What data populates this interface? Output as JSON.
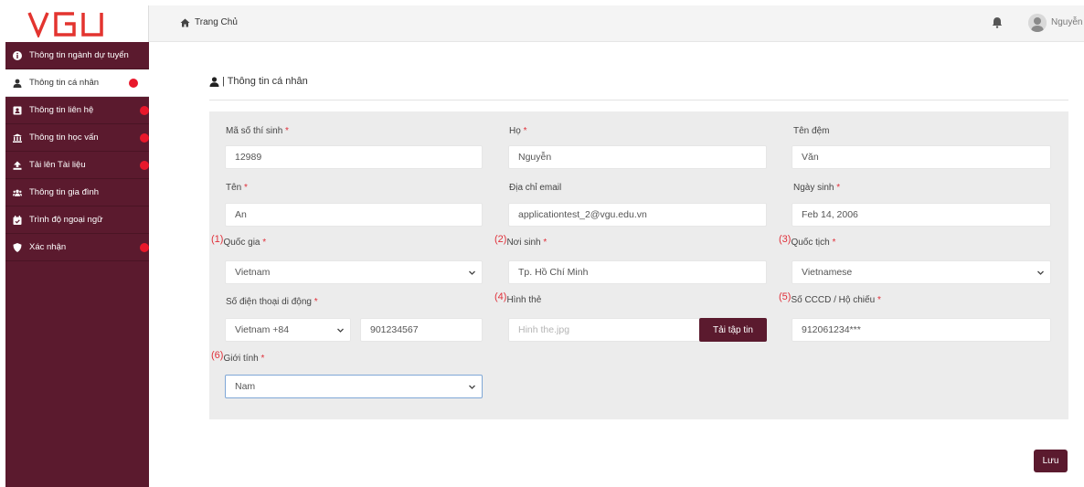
{
  "logo": {
    "text": "VGU"
  },
  "sidebar": {
    "items": [
      {
        "label": "Thông tin ngành dự tuyển",
        "icon": "info-circle-icon",
        "dot": false,
        "active": false
      },
      {
        "label": "Thông tin cá nhân",
        "icon": "user-icon",
        "dot": true,
        "active": true
      },
      {
        "label": "Thông tin liên hệ",
        "icon": "address-book-icon",
        "dot": true,
        "active": false
      },
      {
        "label": "Thông tin học vấn",
        "icon": "university-icon",
        "dot": true,
        "active": false
      },
      {
        "label": "Tải lên Tài liệu",
        "icon": "upload-icon",
        "dot": true,
        "active": false
      },
      {
        "label": "Thông tin gia đình",
        "icon": "users-icon",
        "dot": false,
        "active": false
      },
      {
        "label": "Trình độ ngoại ngữ",
        "icon": "calendar-check-icon",
        "dot": false,
        "active": false
      },
      {
        "label": "Xác nhận",
        "icon": "shield-icon",
        "dot": true,
        "active": false
      }
    ]
  },
  "topbar": {
    "home_label": "Trang Chủ",
    "username": "Nguyễn"
  },
  "page": {
    "title": "| Thông tin cá nhân"
  },
  "form": {
    "student_id": {
      "label": "Mã số thí sinh",
      "value": "12989"
    },
    "last_name": {
      "label": "Họ",
      "value": "Nguyễn"
    },
    "middle_name": {
      "label": "Tên đệm",
      "value": "Văn"
    },
    "first_name": {
      "label": "Tên",
      "value": "An"
    },
    "email": {
      "label": "Địa chỉ email",
      "value": "applicationtest_2@vgu.edu.vn"
    },
    "birth_date": {
      "label": "Ngày sinh",
      "value": "Feb 14, 2006"
    },
    "country": {
      "num": "(1)",
      "label": "Quốc gia",
      "value": "Vietnam"
    },
    "birth_place": {
      "num": "(2)",
      "label": "Nơi sinh",
      "value": "Tp. Hồ Chí Minh"
    },
    "nationality": {
      "num": "(3)",
      "label": "Quốc tịch",
      "value": "Vietnamese"
    },
    "phone": {
      "label": "Số điện thoại di động",
      "code": "Vietnam +84",
      "value": "901234567"
    },
    "photo": {
      "num": "(4)",
      "label": "Hình thẻ",
      "placeholder": "Hinh the.jpg",
      "button": "Tải tập tin"
    },
    "id_card": {
      "num": "(5)",
      "label": "Số CCCD / Hộ chiếu",
      "value": "912061234***"
    },
    "gender": {
      "num": "(6)",
      "label": "Giới tính",
      "value": "Nam"
    },
    "required_mark": "*"
  },
  "actions": {
    "save_label": "Lưu"
  },
  "colors": {
    "brand": "#5b1a2e",
    "dot": "#e8182b",
    "required": "#e0303a",
    "panel": "#ececec"
  }
}
